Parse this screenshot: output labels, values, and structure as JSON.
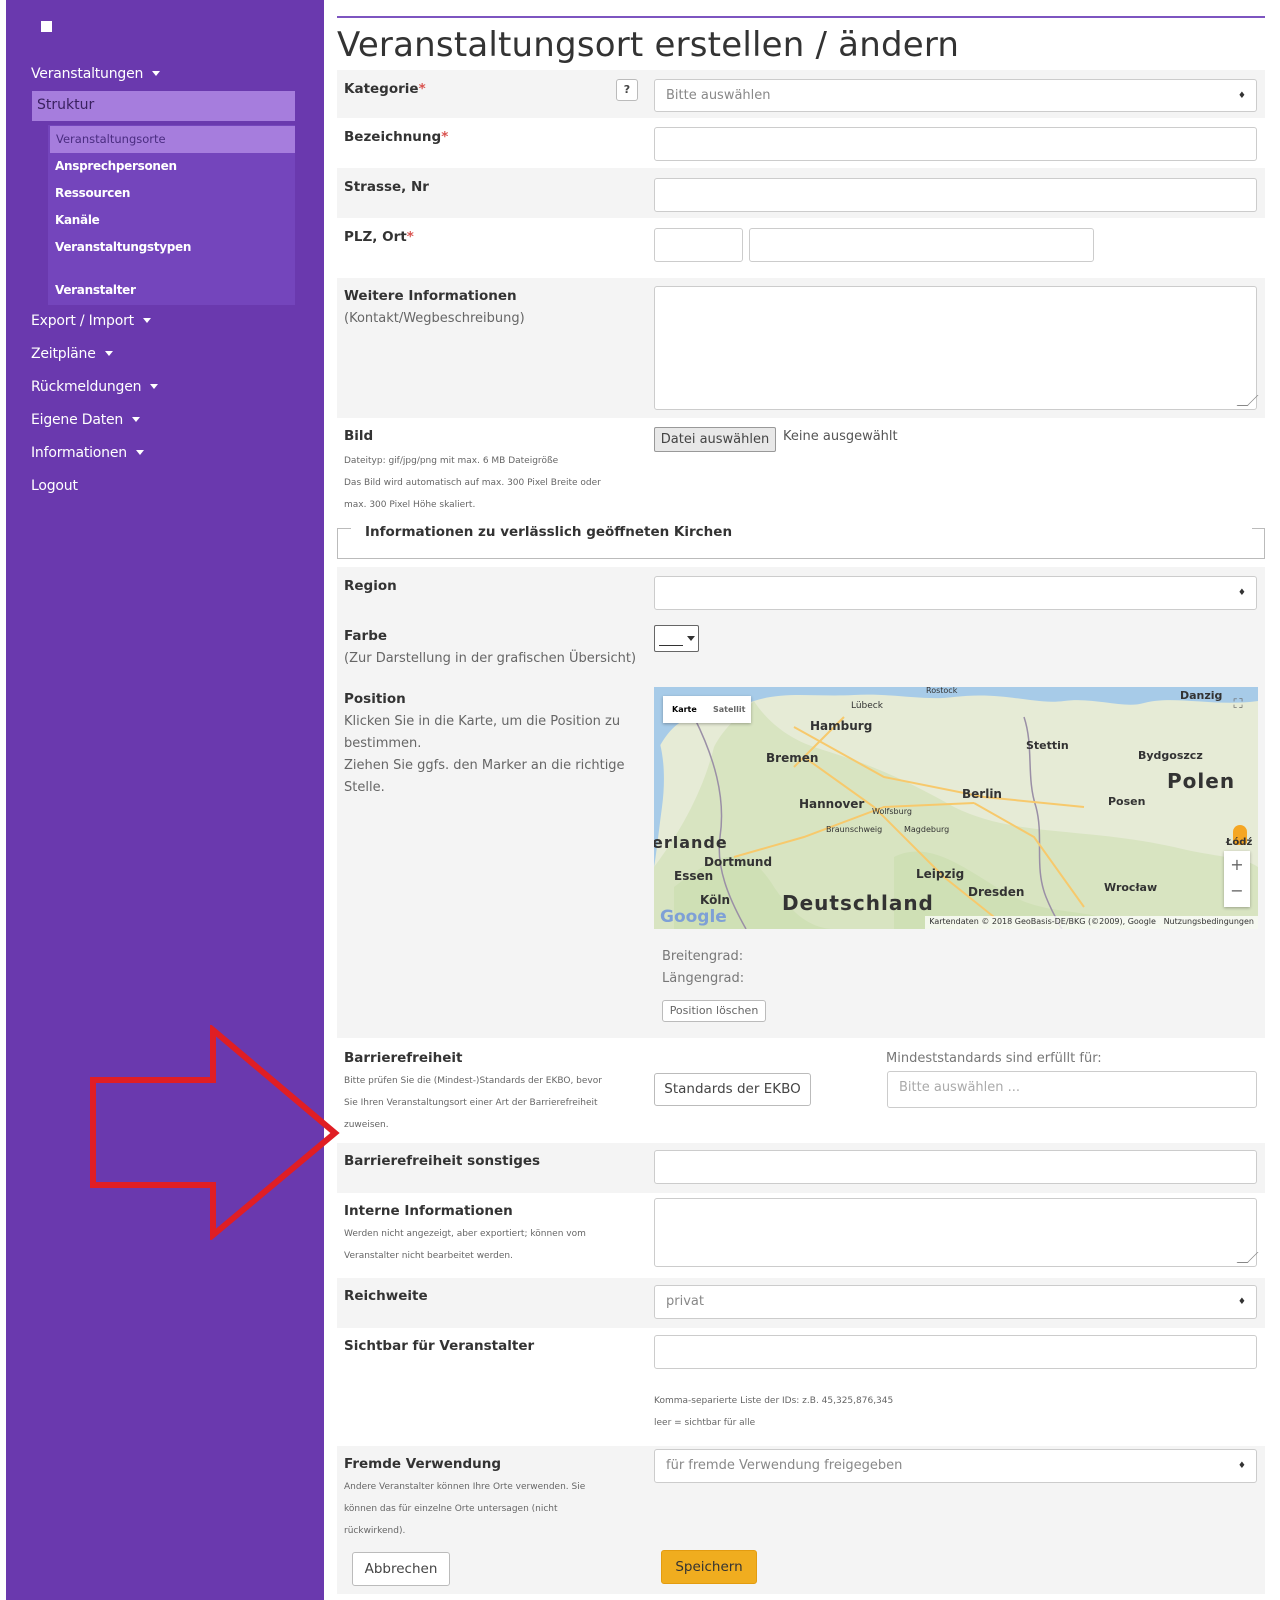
{
  "sidebar": {
    "menu": [
      {
        "label": "Veranstaltungen",
        "caret": true
      },
      {
        "label": "Struktur",
        "active": true
      },
      {
        "label": "Export / Import",
        "caret": true
      },
      {
        "label": "Zeitpläne",
        "caret": true
      },
      {
        "label": "Rückmeldungen",
        "caret": true
      },
      {
        "label": "Eigene Daten",
        "caret": true
      },
      {
        "label": "Informationen",
        "caret": true
      },
      {
        "label": "Logout"
      }
    ],
    "submenu": [
      {
        "label": "Veranstaltungsorte",
        "active": true
      },
      {
        "label": "Ansprechpersonen"
      },
      {
        "label": "Ressourcen"
      },
      {
        "label": "Kanäle"
      },
      {
        "label": "Veranstaltungstypen"
      },
      {
        "label": "Veranstalter"
      }
    ]
  },
  "page": {
    "title": "Veranstaltungsort erstellen / ändern"
  },
  "form": {
    "kategorie": {
      "label": "Kategorie",
      "help": "?",
      "value": "Bitte auswählen"
    },
    "bezeichnung": {
      "label": "Bezeichnung"
    },
    "strasse": {
      "label": "Strasse, Nr"
    },
    "plz_ort": {
      "label": "PLZ, Ort"
    },
    "weitere": {
      "label": "Weitere Informationen",
      "hint": "(Kontakt/Wegbeschreibung)"
    },
    "bild": {
      "label": "Bild",
      "hint1": "Dateityp: gif/jpg/png mit max. 6 MB Dateigröße",
      "hint2": "Das Bild wird automatisch auf max. 300 Pixel Breite oder",
      "hint3": "max. 300 Pixel Höhe skaliert.",
      "button": "Datei auswählen",
      "status": "Keine ausgewählt"
    },
    "kirchen_legend": "Informationen zu verlässlich geöffneten Kirchen",
    "region": {
      "label": "Region",
      "value": ""
    },
    "farbe": {
      "label": "Farbe",
      "hint": "(Zur Darstellung in der grafischen Übersicht)"
    },
    "position": {
      "label": "Position",
      "hint1": "Klicken Sie in die Karte, um die Position zu",
      "hint2": "bestimmen.",
      "hint3": "Ziehen Sie ggfs. den Marker an die richtige",
      "hint4": "Stelle.",
      "breitengrad": "Breitengrad:",
      "laengengrad": "Längengrad:",
      "delete_button": "Position löschen"
    },
    "map": {
      "tab_karte": "Karte",
      "tab_satellit": "Satellit",
      "labels": {
        "rostock": "Rostock",
        "danzig": "Danzig",
        "luebeck": "Lübeck",
        "hamburg": "Hamburg",
        "stettin": "Stettin",
        "bydgoszcz": "Bydgoszcz",
        "bremen": "Bremen",
        "polen": "Polen",
        "berlin": "Berlin",
        "hannover": "Hannover",
        "wolfsburg": "Wolfsburg",
        "posen": "Posen",
        "braunschweig": "Braunschweig",
        "magdeburg": "Magdeburg",
        "niederlande": "erlande",
        "dortmund": "Dortmund",
        "essen": "Essen",
        "leipzig": "Leipzig",
        "koeln": "Köln",
        "deutschland": "Deutschland",
        "dresden": "Dresden",
        "wroclaw": "Wrocław",
        "lodz": "Łódź"
      },
      "google": "Google",
      "attribution": "Kartendaten © 2018 GeoBasis-DE/BKG (©2009), Google",
      "terms": "Nutzungsbedingungen",
      "zoom_in": "+",
      "zoom_out": "−"
    },
    "barriere": {
      "label": "Barrierefreiheit",
      "hint1": "Bitte prüfen Sie die (Mindest-)Standards der EKBO, bevor",
      "hint2": "Sie Ihren Veranstaltungsort einer Art der Barrierefreiheit",
      "hint3": "zuweisen.",
      "button": "Standards der EKBO",
      "mindest_label": "Mindeststandards sind erfüllt für:",
      "mindest_placeholder": "Bitte auswählen ..."
    },
    "barriere_sonstiges": {
      "label": "Barrierefreiheit sonstiges"
    },
    "interne": {
      "label": "Interne Informationen",
      "hint1": "Werden nicht angezeigt, aber exportiert; können vom",
      "hint2": "Veranstalter nicht bearbeitet werden."
    },
    "reichweite": {
      "label": "Reichweite",
      "value": "privat"
    },
    "sichtbar": {
      "label": "Sichtbar für Veranstalter",
      "hint1": "Komma-separierte Liste der IDs: z.B. 45,325,876,345",
      "hint2": "leer = sichtbar für alle"
    },
    "fremde": {
      "label": "Fremde Verwendung",
      "hint1": "Andere Veranstalter können Ihre Orte verwenden. Sie",
      "hint2": "können das für einzelne Orte untersagen (nicht",
      "hint3": "rückwirkend).",
      "value": "für fremde Verwendung freigegeben"
    },
    "cancel_button": "Abbrechen",
    "save_button": "Speichern"
  },
  "colors": {
    "sidebar": "#6a39ae",
    "active_item": "#a67ddd",
    "save": "#f0ad1f",
    "arrow": "#e01e24",
    "required": "#d9534f"
  }
}
